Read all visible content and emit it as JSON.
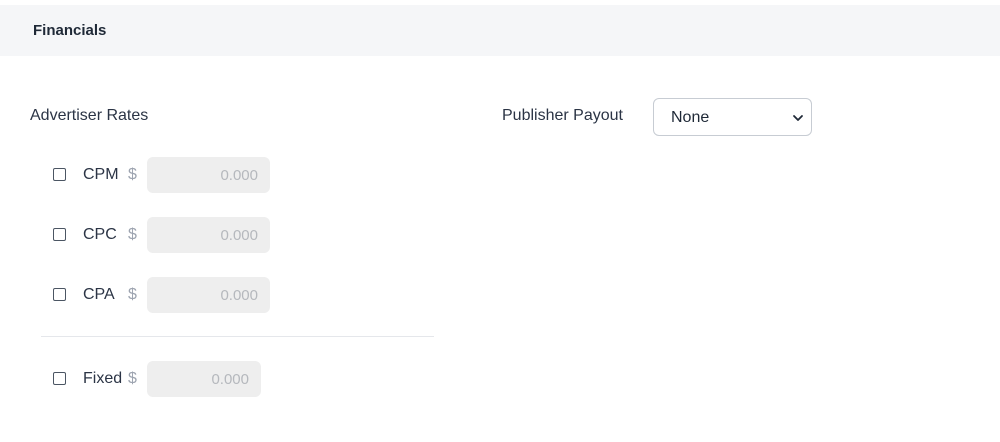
{
  "section": {
    "title": "Financials"
  },
  "advertiser": {
    "label": "Advertiser Rates",
    "rates": [
      {
        "name": "CPM",
        "currency": "$",
        "placeholder": "0.000",
        "checked": false
      },
      {
        "name": "CPC",
        "currency": "$",
        "placeholder": "0.000",
        "checked": false
      },
      {
        "name": "CPA",
        "currency": "$",
        "placeholder": "0.000",
        "checked": false
      }
    ],
    "fixed": {
      "name": "Fixed",
      "currency": "$",
      "placeholder": "0.000",
      "checked": false
    }
  },
  "publisher": {
    "label": "Publisher Payout",
    "selected": "None"
  },
  "icons": {
    "select_chevron": "chevron-down-icon"
  }
}
